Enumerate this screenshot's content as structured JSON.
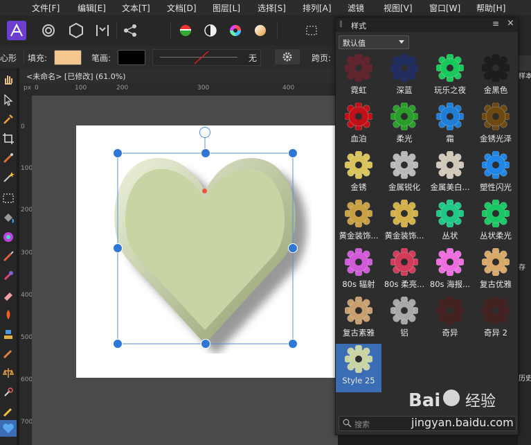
{
  "menu": [
    "文件[F]",
    "编辑[E]",
    "文本[T]",
    "文档[D]",
    "图层[L]",
    "选择[S]",
    "排列[A]",
    "滤镜",
    "视图[V]",
    "窗口[W]",
    "帮助[H]"
  ],
  "context": {
    "shape_label": "心形",
    "fill_label": "填充:",
    "fill_color": "#f4c78e",
    "stroke_label": "笔画:",
    "stroke_color": "#000000",
    "stroke_value": "无",
    "span_label": "跨页:"
  },
  "doc_tab": "<未命名> [已修改] (61.0%)",
  "ruler": {
    "unit": "px",
    "h_ticks": [
      "0",
      "100",
      "200",
      "300",
      "400"
    ],
    "v_ticks": [
      "0",
      "100",
      "200",
      "300",
      "400",
      "500",
      "600",
      "700"
    ]
  },
  "heart": {
    "fill": "#c8d4a4",
    "edge": "#9fb07a"
  },
  "styles_panel": {
    "title": "样式",
    "preset": "默认值",
    "search_placeholder": "搜索",
    "swatches": [
      {
        "label": "霓虹",
        "icon": "gear-neon-icon",
        "color": "#8a1f2e",
        "dark": true
      },
      {
        "label": "深蓝",
        "icon": "gear-deep-blue-icon",
        "color": "#1a2f8a",
        "dark": true
      },
      {
        "label": "玩乐之夜",
        "icon": "gear-fun-night-icon",
        "color": "#19c85a",
        "dark": false
      },
      {
        "label": "金黑色",
        "icon": "gear-gold-black-icon",
        "color": "#111111",
        "dark": true
      },
      {
        "label": "血泊",
        "icon": "gear-blood-icon",
        "color": "#c01018",
        "dark": false
      },
      {
        "label": "柔光",
        "icon": "gear-soft-light-icon",
        "color": "#2a9d2c",
        "dark": false
      },
      {
        "label": "霜",
        "icon": "gear-frost-icon",
        "color": "#1f7fd6",
        "dark": false
      },
      {
        "label": "金锈光泽",
        "icon": "gear-gold-rust-gloss-icon",
        "color": "#6e4a12",
        "dark": false
      },
      {
        "label": "金锈",
        "icon": "gear-gold-rust-icon",
        "color": "#d8c45a",
        "dark": false
      },
      {
        "label": "金属锐化",
        "icon": "gear-metal-sharpen-icon",
        "color": "#b8b8b8",
        "dark": false
      },
      {
        "label": "金属美白...",
        "icon": "gear-metal-white-icon",
        "color": "#d0c8b8",
        "dark": false
      },
      {
        "label": "塑性闪光",
        "icon": "gear-plastic-flash-icon",
        "color": "#1f86e6",
        "dark": false
      },
      {
        "label": "黄金装饰...",
        "icon": "gear-gold-deco-1-icon",
        "color": "#c7a043",
        "dark": false
      },
      {
        "label": "黄金装饰...",
        "icon": "gear-gold-deco-2-icon",
        "color": "#d4b04a",
        "dark": false
      },
      {
        "label": "丛状",
        "icon": "gear-cluster-icon",
        "color": "#1fc886",
        "dark": false
      },
      {
        "label": "丛状柔光",
        "icon": "gear-cluster-soft-icon",
        "color": "#19c864",
        "dark": false
      },
      {
        "label": "80s 辐射",
        "icon": "gear-80s-radiation-icon",
        "color": "#d05ad8",
        "dark": false
      },
      {
        "label": "80s 柔亮...",
        "icon": "gear-80s-soft-icon",
        "color": "#d23c5a",
        "dark": false
      },
      {
        "label": "80s 海报...",
        "icon": "gear-80s-poster-icon",
        "color": "#ee6ee0",
        "dark": false
      },
      {
        "label": "复古优雅",
        "icon": "gear-retro-elegant-icon",
        "color": "#d8a868",
        "dark": false
      },
      {
        "label": "复古素雅",
        "icon": "gear-retro-plain-icon",
        "color": "#c8a070",
        "dark": false
      },
      {
        "label": "铝",
        "icon": "gear-aluminum-icon",
        "color": "#a8a8a8",
        "dark": false
      },
      {
        "label": "奇异",
        "icon": "gear-strange-icon",
        "color": "#5a1a1a",
        "dark": true
      },
      {
        "label": "奇异 2",
        "icon": "gear-strange-2-icon",
        "color": "#5a1a1a",
        "dark": true
      },
      {
        "label": "Style 25",
        "icon": "gear-style-25-icon",
        "color": "#c8d4a4",
        "dark": false,
        "selected": true
      }
    ]
  },
  "right_strip": {
    "text1": "样本",
    "text2": "存",
    "text3": "历史"
  },
  "watermark": {
    "logo": "Bai 经验",
    "url": "jingyan.baidu.com"
  }
}
